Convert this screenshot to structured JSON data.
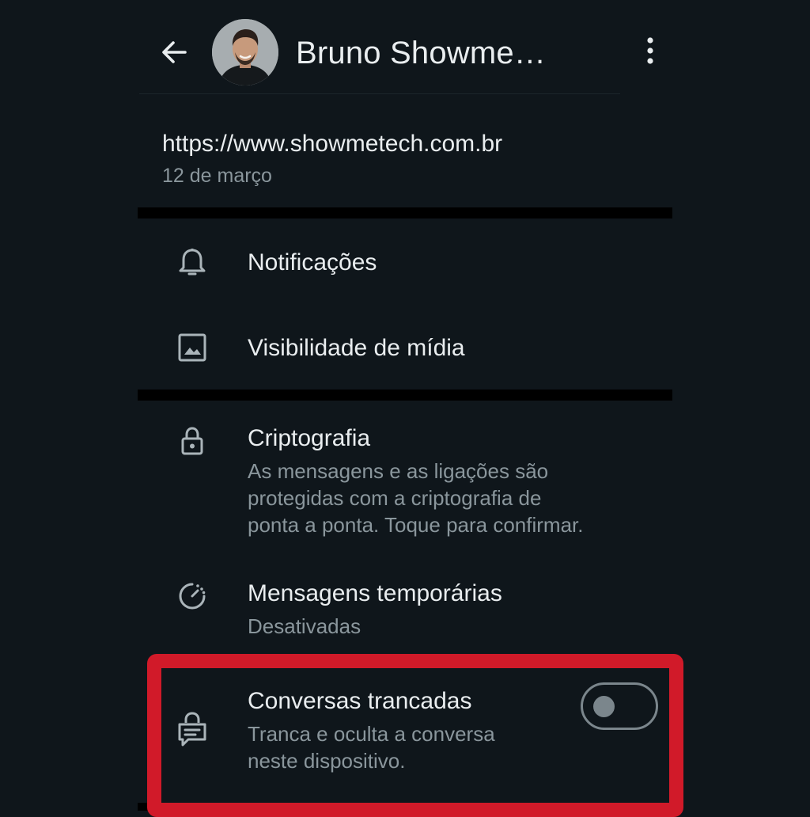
{
  "header": {
    "contact_name": "Bruno Showme…"
  },
  "link": {
    "url": "https://www.showmetech.com.br",
    "date": "12 de março"
  },
  "settings": {
    "notifications": {
      "title": "Notificações",
      "icon": "bell-icon"
    },
    "media_visibility": {
      "title": "Visibilidade de mídia",
      "icon": "image-icon"
    },
    "encryption": {
      "title": "Criptografia",
      "subtitle_lines": [
        "As mensagens e as ligações são",
        "protegidas com a criptografia de",
        "ponta a ponta. Toque para confirmar."
      ],
      "icon": "lock-icon"
    },
    "disappearing": {
      "title": "Mensagens temporárias",
      "subtitle": "Desativadas",
      "icon": "timer-icon"
    },
    "locked_chats": {
      "title": "Conversas trancadas",
      "subtitle_lines": [
        "Tranca e oculta a conversa",
        "neste dispositivo."
      ],
      "icon": "chat-lock-icon",
      "toggle_on": false
    }
  },
  "colors": {
    "background": "#0f161b",
    "primary_text": "#e9edef",
    "secondary_text": "#8a969c",
    "highlight": "#d11a29"
  }
}
